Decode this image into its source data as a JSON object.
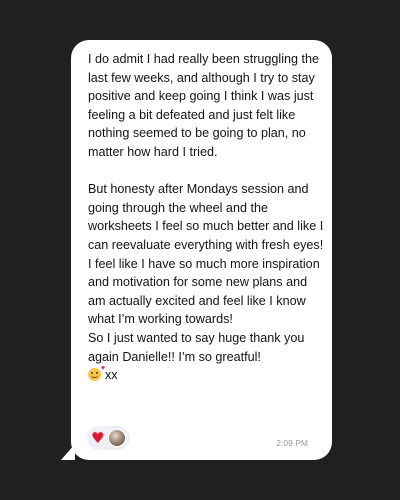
{
  "message": {
    "paragraph_1": "I do admit I had really been struggling the last few weeks, and although I try to stay positive and keep going I think I was just feeling a bit defeated and just felt like nothing seemed to be going to plan, no matter how hard I tried.",
    "paragraph_2": "But honesty after Mondays session and  going through the wheel and the worksheets I feel so much better and like I can reevaluate everything with fresh eyes!",
    "paragraph_3": "I feel like I have so much more inspiration and motivation for some new plans and am actually excited and feel like I know what I’m working towards!",
    "paragraph_4": "So I just wanted to say huge thank you again Danielle!! I’m so greatful!",
    "sign_off": "xx",
    "sign_off_emoji": "smiling-face-with-hearts-icon"
  },
  "reactions": [
    {
      "type": "heart",
      "icon": "heart-icon",
      "color": "#e0182f"
    },
    {
      "type": "avatar",
      "icon": "avatar"
    }
  ],
  "timestamp": "2:09 PM",
  "colors": {
    "background": "#221f1f",
    "bubble": "#ffffff",
    "text": "#141414",
    "timestamp": "#9a9a9a",
    "reaction_pill": "#eef0f6"
  }
}
